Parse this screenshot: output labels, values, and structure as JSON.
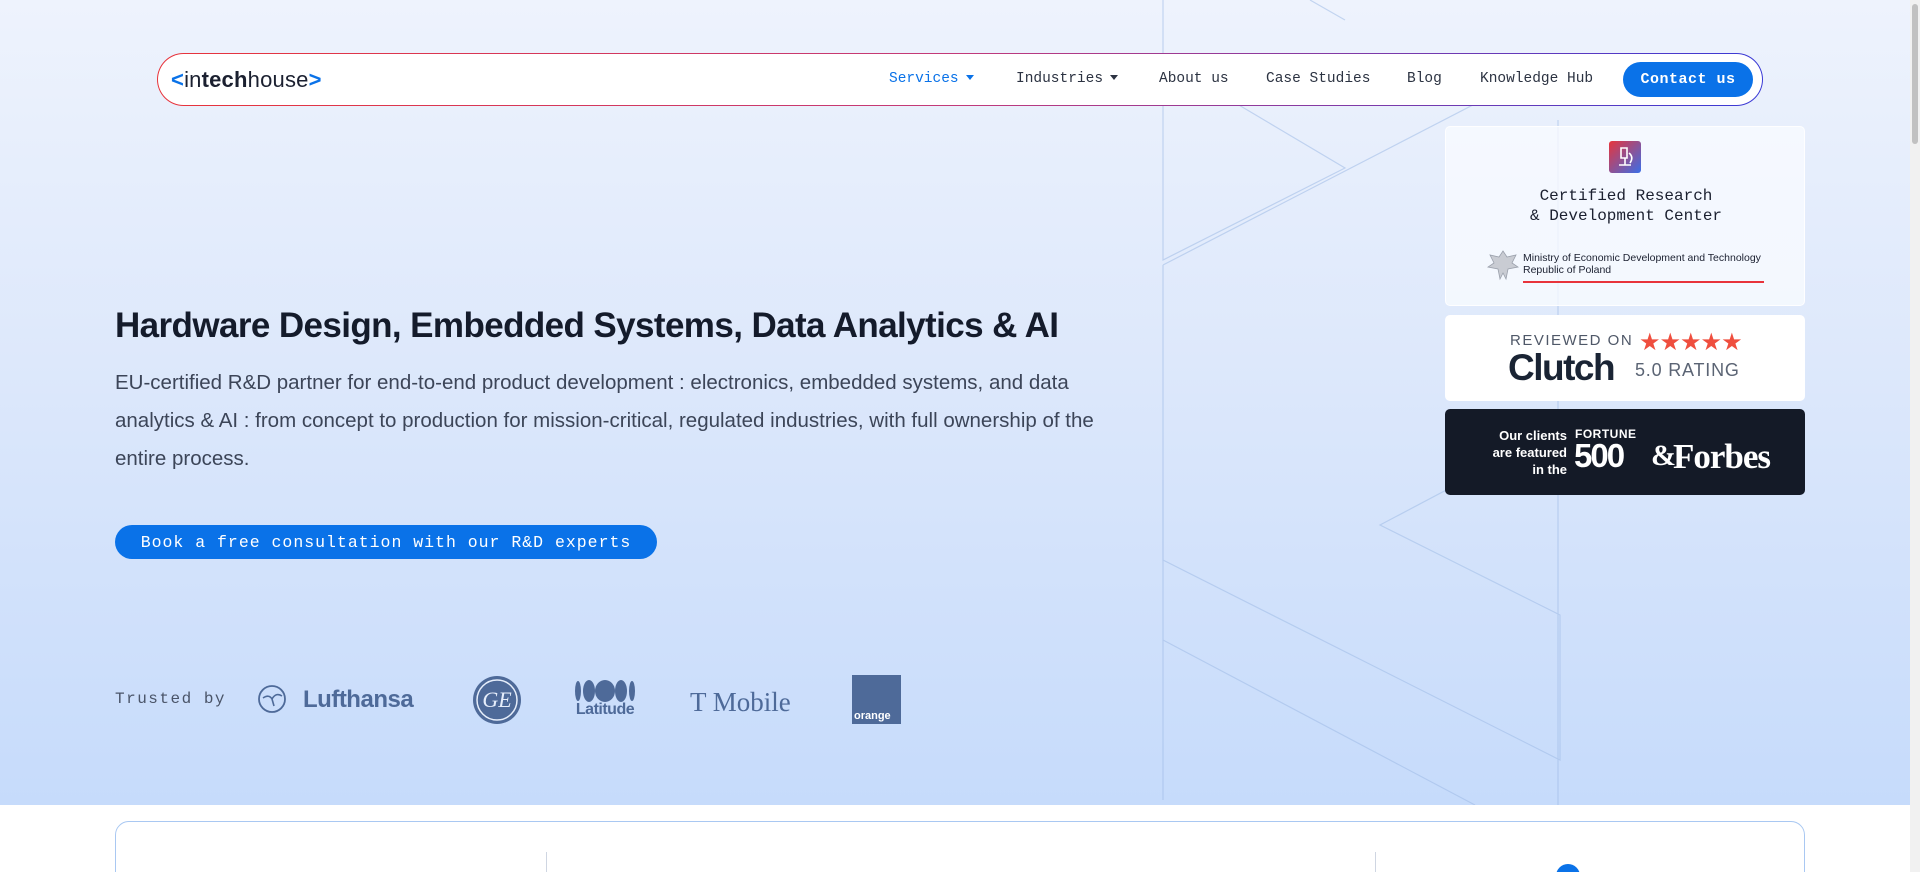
{
  "brand": {
    "logo_prefix": "<",
    "logo_in": "in",
    "logo_tech": "tech",
    "logo_house": "house",
    "logo_suffix": ">",
    "accent": "#0a72e8"
  },
  "nav": {
    "items": [
      {
        "label": "Services",
        "dropdown": true,
        "active": true
      },
      {
        "label": "Industries",
        "dropdown": true,
        "active": false
      },
      {
        "label": "About us",
        "dropdown": false,
        "active": false
      },
      {
        "label": "Case Studies",
        "dropdown": false,
        "active": false
      },
      {
        "label": "Blog",
        "dropdown": false,
        "active": false
      },
      {
        "label": "Knowledge Hub",
        "dropdown": false,
        "active": false
      }
    ],
    "contact_label": "Contact us"
  },
  "hero": {
    "headline": "Hardware Design, Embedded Systems, Data Analytics & AI",
    "subtitle": "EU-certified R&D partner for end-to-end product development : electronics, embedded systems, and data analytics & AI : from concept to production for mission-critical, regulated industries, with full ownership of the entire process.",
    "cta_label": "Book a free consultation with our R&D experts"
  },
  "trusted": {
    "label": "Trusted by",
    "logos": [
      "Lufthansa",
      "GE",
      "Latitude",
      "T Mobile",
      "orange"
    ]
  },
  "badges": {
    "certified_line1": "Certified Research",
    "certified_line2": "& Development Center",
    "ministry_line1": "Ministry of Economic Development and Technology",
    "ministry_line2": "Republic of Poland",
    "clutch_reviewed": "REVIEWED ON",
    "clutch_name": "Clutch",
    "clutch_rating": "5.0 RATING",
    "clutch_stars": 5,
    "featured_line1": "Our clients",
    "featured_line2": "are featured",
    "featured_line3": "in the",
    "fortune_top": "FORTUNE",
    "fortune_num": "500",
    "amp": "&",
    "forbes": "Forbes"
  },
  "icons": {
    "certified": "microscope-icon",
    "ministry": "eagle-emblem-icon",
    "caret": "chevron-down-icon"
  }
}
